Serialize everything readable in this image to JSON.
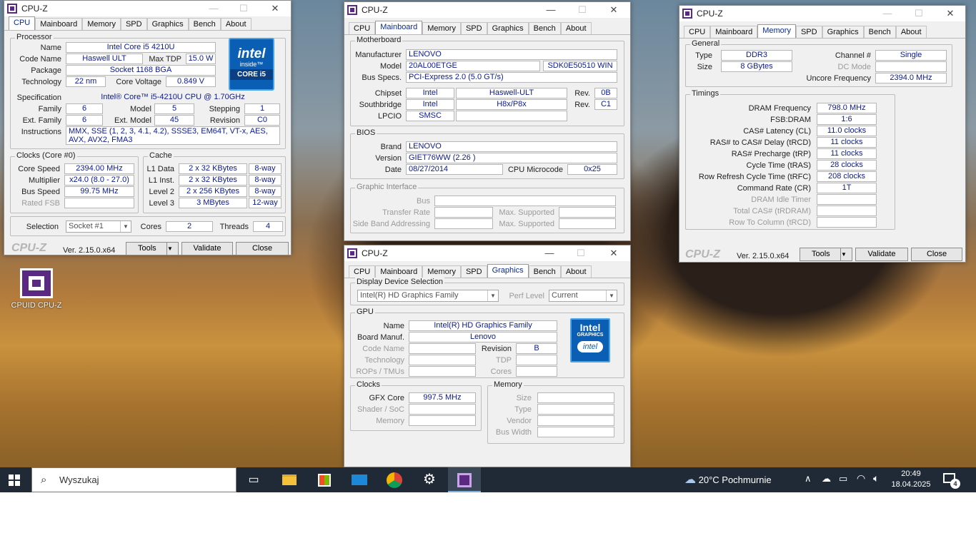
{
  "desktop": {
    "icon_label": "CPUID CPU-Z"
  },
  "app_title": "CPU-Z",
  "tabs": [
    "CPU",
    "Mainboard",
    "Memory",
    "SPD",
    "Graphics",
    "Bench",
    "About"
  ],
  "footer": {
    "logo": "CPU-Z",
    "version": "Ver. 2.15.0.x64",
    "tools": "Tools",
    "validate": "Validate",
    "close": "Close"
  },
  "cpu": {
    "processor_label": "Processor",
    "name_label": "Name",
    "name": "Intel Core i5 4210U",
    "codename_label": "Code Name",
    "codename": "Haswell ULT",
    "maxtdp_label": "Max TDP",
    "maxtdp": "15.0 W",
    "package_label": "Package",
    "package": "Socket 1168 BGA",
    "tech_label": "Technology",
    "tech": "22 nm",
    "voltage_label": "Core Voltage",
    "voltage": "0.849 V",
    "spec_label": "Specification",
    "spec": "Intel® Core™ i5-4210U CPU @ 1.70GHz",
    "family_label": "Family",
    "family": "6",
    "model_label": "Model",
    "model": "5",
    "stepping_label": "Stepping",
    "stepping": "1",
    "extfamily_label": "Ext. Family",
    "extfamily": "6",
    "extmodel_label": "Ext. Model",
    "extmodel": "45",
    "revision_label": "Revision",
    "revision": "C0",
    "instr_label": "Instructions",
    "instr": "MMX, SSE (1, 2, 3, 4.1, 4.2), SSSE3, EM64T, VT-x, AES, AVX, AVX2, FMA3",
    "intel_logo": {
      "brand": "intel",
      "line1": "inside™",
      "line2": "CORE i5"
    },
    "clocks_label": "Clocks (Core #0)",
    "corespeed_label": "Core Speed",
    "corespeed": "2394.00 MHz",
    "multiplier_label": "Multiplier",
    "multiplier": "x24.0 (8.0 - 27.0)",
    "busspeed_label": "Bus Speed",
    "busspeed": "99.75 MHz",
    "ratedfsb_label": "Rated FSB",
    "ratedfsb": "",
    "cache_label": "Cache",
    "l1d_label": "L1 Data",
    "l1d": "2 x 32 KBytes",
    "l1d_way": "8-way",
    "l1i_label": "L1 Inst.",
    "l1i": "2 x 32 KBytes",
    "l1i_way": "8-way",
    "l2_label": "Level 2",
    "l2": "2 x 256 KBytes",
    "l2_way": "8-way",
    "l3_label": "Level 3",
    "l3": "3 MBytes",
    "l3_way": "12-way",
    "selection_label": "Selection",
    "selection": "Socket #1",
    "cores_label": "Cores",
    "cores": "2",
    "threads_label": "Threads",
    "threads": "4"
  },
  "mainboard": {
    "mb_label": "Motherboard",
    "manufacturer_label": "Manufacturer",
    "manufacturer": "LENOVO",
    "model_label": "Model",
    "model": "20AL00ETGE",
    "model2": "SDK0E50510 WIN",
    "busspecs_label": "Bus Specs.",
    "busspecs": "PCI-Express 2.0 (5.0 GT/s)",
    "chipset_label": "Chipset",
    "chipset": "Intel",
    "chipset2": "Haswell-ULT",
    "chipset_rev_label": "Rev.",
    "chipset_rev": "0B",
    "south_label": "Southbridge",
    "south": "Intel",
    "south2": "H8x/P8x",
    "south_rev_label": "Rev.",
    "south_rev": "C1",
    "lpcio_label": "LPCIO",
    "lpcio": "SMSC",
    "bios_label": "BIOS",
    "brand_label": "Brand",
    "brand": "LENOVO",
    "version_label": "Version",
    "version": "GIET76WW (2.26 )",
    "date_label": "Date",
    "date": "08/27/2014",
    "microcode_label": "CPU Microcode",
    "microcode": "0x25",
    "gi_label": "Graphic Interface",
    "bus_label": "Bus",
    "transfer_label": "Transfer Rate",
    "maxsup_label": "Max. Supported",
    "sideband_label": "Side Band Addressing",
    "maxsup2_label": "Max. Supported"
  },
  "memory": {
    "general_label": "General",
    "type_label": "Type",
    "type": "DDR3",
    "channel_label": "Channel #",
    "channel": "Single",
    "size_label": "Size",
    "size": "8 GBytes",
    "dcmode_label": "DC Mode",
    "dcmode": "",
    "uncore_label": "Uncore Frequency",
    "uncore": "2394.0 MHz",
    "timings_label": "Timings",
    "rows": [
      {
        "label": "DRAM Frequency",
        "value": "798.0 MHz",
        "gray": false
      },
      {
        "label": "FSB:DRAM",
        "value": "1:6",
        "gray": false
      },
      {
        "label": "CAS# Latency (CL)",
        "value": "11.0 clocks",
        "gray": false
      },
      {
        "label": "RAS# to CAS# Delay (tRCD)",
        "value": "11 clocks",
        "gray": false
      },
      {
        "label": "RAS# Precharge (tRP)",
        "value": "11 clocks",
        "gray": false
      },
      {
        "label": "Cycle Time (tRAS)",
        "value": "28 clocks",
        "gray": false
      },
      {
        "label": "Row Refresh Cycle Time (tRFC)",
        "value": "208 clocks",
        "gray": false
      },
      {
        "label": "Command Rate (CR)",
        "value": "1T",
        "gray": false
      },
      {
        "label": "DRAM Idle Timer",
        "value": "",
        "gray": true
      },
      {
        "label": "Total CAS# (tRDRAM)",
        "value": "",
        "gray": true
      },
      {
        "label": "Row To Column (tRCD)",
        "value": "",
        "gray": true
      }
    ]
  },
  "graphics": {
    "dds_label": "Display Device Selection",
    "device": "Intel(R) HD Graphics Family",
    "perf_label": "Perf Level",
    "perf": "Current",
    "gpu_label": "GPU",
    "name_label": "Name",
    "name": "Intel(R) HD Graphics Family",
    "board_label": "Board Manuf.",
    "board": "Lenovo",
    "codename_label": "Code Name",
    "revision_label": "Revision",
    "revision": "B",
    "technology_label": "Technology",
    "tdp_label": "TDP",
    "rops_label": "ROPs / TMUs",
    "cores_label": "Cores",
    "intel_logo": {
      "line1": "Intel",
      "line2": "GRAPHICS",
      "brand": "intel"
    },
    "clocks_label": "Clocks",
    "gfxcore_label": "GFX Core",
    "gfxcore": "997.5 MHz",
    "shader_label": "Shader / SoC",
    "memclk_label": "Memory",
    "memory_label": "Memory",
    "msize_label": "Size",
    "mtype_label": "Type",
    "mvendor_label": "Vendor",
    "mbus_label": "Bus Width"
  },
  "taskbar": {
    "search_placeholder": "Wyszukaj",
    "weather": "20°C  Pochmurnie",
    "time": "20:49",
    "date": "18.04.2025",
    "notifications": "4"
  }
}
